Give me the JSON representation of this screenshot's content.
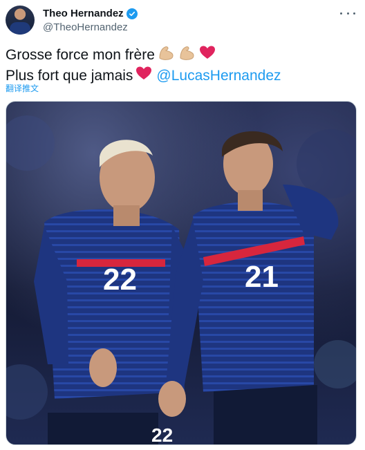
{
  "tweet": {
    "display_name": "Theo Hernandez",
    "handle": "@TheoHernandez",
    "verified": true,
    "line1": "Grosse force mon frère",
    "line2": "Plus fort que jamais",
    "mention": "@LucasHernandez",
    "translate_label": "翻译推文",
    "emojis": [
      "flexed-biceps",
      "flexed-biceps",
      "red-heart",
      "red-heart"
    ]
  },
  "media": {
    "player_left_number": "22",
    "player_right_number": "21",
    "shorts_number": "22"
  },
  "colors": {
    "accent": "#1d9bf0",
    "text": "#0f1419",
    "muted": "#536471",
    "heart": "#e0245e",
    "jersey": "#1f3a8a",
    "jersey_stripe": "#d7263d"
  },
  "icons": [
    "verified-badge-icon",
    "more-options-icon"
  ]
}
